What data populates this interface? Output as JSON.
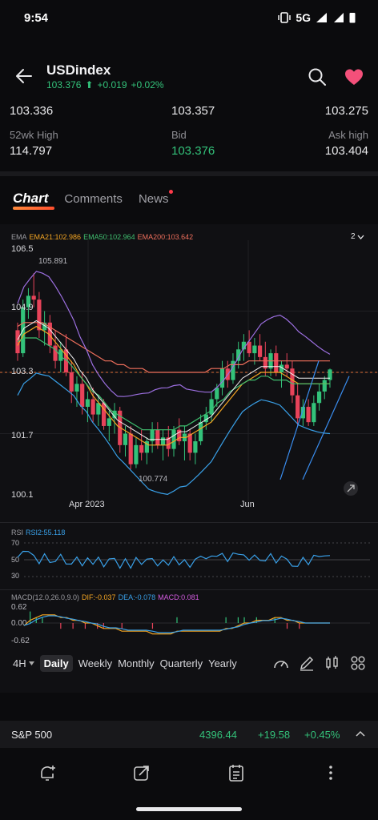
{
  "status": {
    "time": "9:54",
    "network": "5G"
  },
  "header": {
    "title": "USDindex",
    "price": "103.376",
    "change": "+0.019",
    "change_pct": "+0.02%"
  },
  "quotes": {
    "open": "103.336",
    "high": "103.357",
    "low": "103.275",
    "week52_high_label": "52wk High",
    "week52_high": "114.797",
    "bid_label": "Bid",
    "bid": "103.376",
    "ask_label": "Ask high",
    "ask": "103.404"
  },
  "tabs": {
    "chart": "Chart",
    "comments": "Comments",
    "news": "News"
  },
  "ema_legend": {
    "name": "EMA",
    "ema21": "EMA21:102.986",
    "ema50": "EMA50:102.964",
    "ema200": "EMA200:103.642",
    "toggle": "2"
  },
  "colors": {
    "up": "#33c27a",
    "down": "#e8435a",
    "ema21": "#f5a623",
    "ema50": "#3fbf6f",
    "ema200": "#ef6f5c",
    "boll": "#9c6fe0",
    "accent": "#ff6a3d"
  },
  "chart_data": {
    "type": "candlestick",
    "price_axis": [
      "106.5",
      "104.9",
      "103.3",
      "101.7",
      "100.1"
    ],
    "x_labels": [
      "Apr 2023",
      "Jun"
    ],
    "last_price_line": 103.3,
    "annotations": [
      "105.891",
      "100.774"
    ],
    "ylim": [
      100.1,
      106.5
    ],
    "candles": [
      {
        "o": 104.4,
        "h": 104.6,
        "l": 103.6,
        "c": 103.8
      },
      {
        "o": 103.8,
        "h": 105.2,
        "l": 103.7,
        "c": 105.0
      },
      {
        "o": 105.0,
        "h": 105.5,
        "l": 104.7,
        "c": 105.3
      },
      {
        "o": 105.3,
        "h": 105.89,
        "l": 105.0,
        "c": 105.2
      },
      {
        "o": 105.2,
        "h": 105.4,
        "l": 104.2,
        "c": 104.4
      },
      {
        "o": 104.4,
        "h": 104.9,
        "l": 104.0,
        "c": 104.6
      },
      {
        "o": 104.6,
        "h": 104.8,
        "l": 103.8,
        "c": 104.0
      },
      {
        "o": 104.0,
        "h": 104.4,
        "l": 103.4,
        "c": 103.6
      },
      {
        "o": 103.6,
        "h": 104.1,
        "l": 103.3,
        "c": 103.9
      },
      {
        "o": 103.9,
        "h": 104.3,
        "l": 103.2,
        "c": 103.3
      },
      {
        "o": 103.3,
        "h": 103.6,
        "l": 102.5,
        "c": 102.8
      },
      {
        "o": 102.8,
        "h": 103.2,
        "l": 102.4,
        "c": 103.0
      },
      {
        "o": 103.0,
        "h": 103.3,
        "l": 102.2,
        "c": 102.4
      },
      {
        "o": 102.4,
        "h": 102.8,
        "l": 102.0,
        "c": 102.6
      },
      {
        "o": 102.6,
        "h": 102.9,
        "l": 102.0,
        "c": 102.2
      },
      {
        "o": 102.2,
        "h": 102.7,
        "l": 101.9,
        "c": 102.5
      },
      {
        "o": 102.5,
        "h": 102.6,
        "l": 101.8,
        "c": 101.9
      },
      {
        "o": 101.9,
        "h": 102.3,
        "l": 101.5,
        "c": 102.1
      },
      {
        "o": 102.1,
        "h": 102.5,
        "l": 101.7,
        "c": 102.3
      },
      {
        "o": 102.3,
        "h": 102.4,
        "l": 101.2,
        "c": 101.4
      },
      {
        "o": 101.4,
        "h": 101.9,
        "l": 101.1,
        "c": 101.7
      },
      {
        "o": 101.7,
        "h": 101.9,
        "l": 100.77,
        "c": 100.9
      },
      {
        "o": 100.9,
        "h": 101.6,
        "l": 100.8,
        "c": 101.4
      },
      {
        "o": 101.4,
        "h": 101.8,
        "l": 101.0,
        "c": 101.2
      },
      {
        "o": 101.2,
        "h": 101.6,
        "l": 100.9,
        "c": 101.5
      },
      {
        "o": 101.5,
        "h": 102.0,
        "l": 101.2,
        "c": 101.8
      },
      {
        "o": 101.8,
        "h": 102.0,
        "l": 101.3,
        "c": 101.4
      },
      {
        "o": 101.4,
        "h": 101.8,
        "l": 101.0,
        "c": 101.6
      },
      {
        "o": 101.6,
        "h": 101.9,
        "l": 101.1,
        "c": 101.3
      },
      {
        "o": 101.3,
        "h": 101.9,
        "l": 101.1,
        "c": 101.8
      },
      {
        "o": 101.8,
        "h": 102.1,
        "l": 101.4,
        "c": 101.5
      },
      {
        "o": 101.5,
        "h": 101.9,
        "l": 101.0,
        "c": 101.7
      },
      {
        "o": 101.7,
        "h": 101.8,
        "l": 101.0,
        "c": 101.2
      },
      {
        "o": 101.2,
        "h": 101.7,
        "l": 100.9,
        "c": 101.5
      },
      {
        "o": 101.5,
        "h": 102.2,
        "l": 101.4,
        "c": 102.0
      },
      {
        "o": 102.0,
        "h": 102.4,
        "l": 101.8,
        "c": 102.2
      },
      {
        "o": 102.2,
        "h": 102.8,
        "l": 102.0,
        "c": 102.6
      },
      {
        "o": 102.6,
        "h": 103.0,
        "l": 102.4,
        "c": 102.9
      },
      {
        "o": 102.9,
        "h": 103.6,
        "l": 102.7,
        "c": 103.4
      },
      {
        "o": 103.4,
        "h": 103.6,
        "l": 102.9,
        "c": 103.1
      },
      {
        "o": 103.1,
        "h": 103.8,
        "l": 103.0,
        "c": 103.6
      },
      {
        "o": 103.6,
        "h": 104.1,
        "l": 103.4,
        "c": 103.9
      },
      {
        "o": 103.9,
        "h": 104.3,
        "l": 103.6,
        "c": 104.1
      },
      {
        "o": 104.1,
        "h": 104.4,
        "l": 103.7,
        "c": 103.8
      },
      {
        "o": 103.8,
        "h": 104.2,
        "l": 103.5,
        "c": 104.0
      },
      {
        "o": 104.0,
        "h": 104.3,
        "l": 103.6,
        "c": 103.7
      },
      {
        "o": 103.7,
        "h": 104.1,
        "l": 103.2,
        "c": 103.4
      },
      {
        "o": 103.4,
        "h": 103.9,
        "l": 103.2,
        "c": 103.8
      },
      {
        "o": 103.8,
        "h": 104.0,
        "l": 103.2,
        "c": 103.3
      },
      {
        "o": 103.3,
        "h": 103.6,
        "l": 102.9,
        "c": 103.5
      },
      {
        "o": 103.5,
        "h": 103.8,
        "l": 103.2,
        "c": 103.4
      },
      {
        "o": 103.4,
        "h": 103.6,
        "l": 102.5,
        "c": 102.7
      },
      {
        "o": 102.7,
        "h": 103.0,
        "l": 101.9,
        "c": 102.1
      },
      {
        "o": 102.1,
        "h": 102.6,
        "l": 101.9,
        "c": 102.4
      },
      {
        "o": 102.4,
        "h": 102.6,
        "l": 101.9,
        "c": 102.0
      },
      {
        "o": 102.0,
        "h": 102.7,
        "l": 101.9,
        "c": 102.5
      },
      {
        "o": 102.5,
        "h": 103.0,
        "l": 102.3,
        "c": 102.8
      },
      {
        "o": 102.8,
        "h": 103.2,
        "l": 102.6,
        "c": 103.1
      },
      {
        "o": 103.1,
        "h": 103.4,
        "l": 102.9,
        "c": 103.376
      }
    ],
    "series": [
      {
        "name": "EMA21",
        "values": [
          104.0,
          104.3,
          104.4,
          104.5,
          104.4,
          104.3,
          104.1,
          103.9,
          103.7,
          103.5,
          103.2,
          103.0,
          102.7,
          102.5,
          102.3,
          102.1,
          101.9,
          101.8,
          101.7,
          101.6,
          101.5,
          101.4,
          101.4,
          101.4,
          101.4,
          101.5,
          101.6,
          101.6,
          101.7,
          101.8,
          101.9,
          102.0,
          102.2,
          102.4,
          102.6,
          102.8,
          103.0,
          103.1,
          103.2,
          103.3,
          103.3,
          103.3,
          103.3,
          103.2,
          103.1,
          103.0,
          103.0,
          103.0,
          103.0,
          103.0,
          103.0
        ]
      },
      {
        "name": "EMA50",
        "values": [
          104.1,
          104.2,
          104.2,
          104.2,
          104.1,
          104.0,
          103.9,
          103.7,
          103.6,
          103.4,
          103.2,
          103.0,
          102.8,
          102.7,
          102.5,
          102.3,
          102.2,
          102.1,
          102.0,
          101.9,
          101.8,
          101.8,
          101.8,
          101.8,
          101.8,
          101.8,
          101.9,
          101.9,
          102.0,
          102.1,
          102.2,
          102.3,
          102.5,
          102.6,
          102.8,
          102.9,
          103.0,
          103.1,
          103.1,
          103.2,
          103.2,
          103.1,
          103.1,
          103.1,
          103.0,
          103.0,
          103.0,
          103.0,
          103.0,
          103.0,
          103.0
        ]
      },
      {
        "name": "EMA200",
        "values": [
          104.5,
          104.6,
          104.6,
          104.6,
          104.6,
          104.5,
          104.4,
          104.3,
          104.2,
          104.1,
          104.0,
          103.9,
          103.8,
          103.7,
          103.6,
          103.6,
          103.5,
          103.5,
          103.4,
          103.4,
          103.4,
          103.3,
          103.3,
          103.3,
          103.3,
          103.3,
          103.3,
          103.3,
          103.3,
          103.3,
          103.3,
          103.4,
          103.4,
          103.4,
          103.5,
          103.5,
          103.5,
          103.6,
          103.6,
          103.6,
          103.6,
          103.6,
          103.6,
          103.6,
          103.6,
          103.6,
          103.6,
          103.6,
          103.6,
          103.6,
          103.6
        ]
      }
    ]
  },
  "rsi": {
    "label": "RSI",
    "value": "RSI2:55.118",
    "levels": [
      "70",
      "50",
      "30"
    ]
  },
  "macd": {
    "label": "MACD(12.0,26.0,9.0)",
    "dif": "DIF:-0.037",
    "dea": "DEA:-0.078",
    "macd": "MACD:0.081",
    "levels": [
      "0.62",
      "0.00",
      "-0.62"
    ]
  },
  "periods": {
    "active": "4H",
    "items": [
      "Daily",
      "Weekly",
      "Monthly",
      "Quarterly",
      "Yearly"
    ],
    "selected": "Daily"
  },
  "index_bar": {
    "name": "S&P 500",
    "price": "4396.44",
    "change": "+19.58",
    "change_pct": "+0.45%"
  }
}
